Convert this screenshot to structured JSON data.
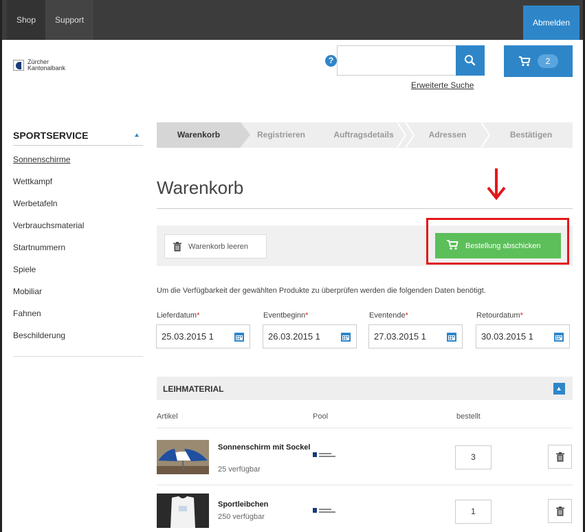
{
  "topbar": {
    "shop": "Shop",
    "support": "Support",
    "logout": "Abmelden"
  },
  "header": {
    "logo_line1": "Zürcher",
    "logo_line2": "Kantonalbank",
    "help": "?",
    "search_value": "",
    "cart_count": "2",
    "advanced_search": "Erweiterte Suche"
  },
  "sidebar": {
    "title": "SPORTSERVICE",
    "items": [
      {
        "label": "Sonnenschirme"
      },
      {
        "label": "Wettkampf"
      },
      {
        "label": "Werbetafeln"
      },
      {
        "label": "Verbrauchsmaterial"
      },
      {
        "label": "Startnummern"
      },
      {
        "label": "Spiele"
      },
      {
        "label": "Mobiliar"
      },
      {
        "label": "Fahnen"
      },
      {
        "label": "Beschilderung"
      }
    ]
  },
  "steps": [
    "Warenkorb",
    "Registrieren",
    "Auftragsdetails",
    "Adressen",
    "Bestätigen"
  ],
  "main": {
    "title": "Warenkorb",
    "clear_label": "Warenkorb leeren",
    "order_label": "Bestellung abschicken",
    "info_text": "Um die Verfügbarkeit der gewählten Produkte zu überprüfen werden die folgenden Daten benötigt.",
    "dates": [
      {
        "label": "Lieferdatum",
        "value": "25.03.2015 1"
      },
      {
        "label": "Eventbeginn",
        "value": "26.03.2015 1"
      },
      {
        "label": "Eventende",
        "value": "27.03.2015 1"
      },
      {
        "label": "Retourdatum",
        "value": "30.03.2015 1"
      }
    ],
    "required_mark": "*"
  },
  "section": {
    "title": "LEIHMATERIAL",
    "columns": {
      "article": "Artikel",
      "pool": "Pool",
      "ordered": "bestellt"
    },
    "items": [
      {
        "name": "Sonnenschirm mit Sockel",
        "available": "25 verfügbar",
        "qty": "3"
      },
      {
        "name": "Sportleibchen",
        "available": "250 verfügbar",
        "qty": "1"
      }
    ]
  },
  "colors": {
    "accent": "#2e86c9",
    "success": "#5cbf5a",
    "highlight": "#e3171b",
    "topbar": "#3c3c3c"
  }
}
